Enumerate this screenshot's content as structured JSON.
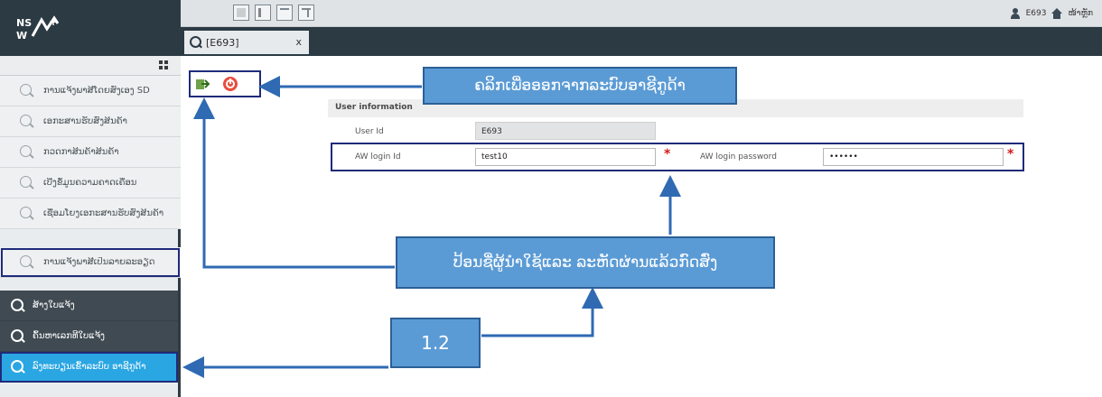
{
  "top_bar": {
    "username": "E693",
    "home_label": "ໜ້າຫຼັກ"
  },
  "tab": {
    "label": "[E693]",
    "close": "x"
  },
  "sidebar": {
    "items": [
      {
        "label": "ການແຈ້ງພາສີໂດຍສົ່ງເອງ SD"
      },
      {
        "label": "ເອກະສານຮັບສົ່ງສິນຄ້າ"
      },
      {
        "label": "ກວດກາສິນຄ້າສິນຄ້າ"
      },
      {
        "label": "ເບີ່ງຂໍ້ມູນຄວາມຄາດເຄື່ອນ"
      },
      {
        "label": "ເຊື່ອມໂຍງເອກະສານຮັບສົ່ງສິນຄ້າ"
      },
      {
        "label": "ການແຈ້ງພາສີເປັນລາຍລະອຽດ"
      }
    ],
    "dark_items": [
      {
        "label": "ສ້າງໃບແຈ້ງ"
      },
      {
        "label": "ຄົ້ນຫາເລກທີໃບແຈ້ງ"
      },
      {
        "label": "ລົງທະບຽນເຂົ້າລະບົບ ອາຊີກູດ້າ"
      }
    ]
  },
  "form": {
    "section_title": "User information",
    "user_id_label": "User Id",
    "user_id_value": "E693",
    "login_id_label": "AW login Id",
    "login_id_value": "test10",
    "password_label": "AW login password",
    "password_value": "••••••",
    "required_mark": "*"
  },
  "annotations": {
    "logout_hint": "ຄລິກເພື່ອອອກຈາກລະບົບອາຊີກູດ້າ",
    "input_hint": "ປ້ອນຊື່ຜູ້ນຳໃຊ້ແລະ ລະຫັດຜ່ານແລ້ວກົດສົ່ງ",
    "step_label": "1.2"
  },
  "colors": {
    "header_dark": "#2b3a43",
    "callout_blue": "#5b9bd5",
    "highlight_box": "#1f2b7a",
    "active_item": "#2aa6e3",
    "required_red": "#d41a1a"
  }
}
